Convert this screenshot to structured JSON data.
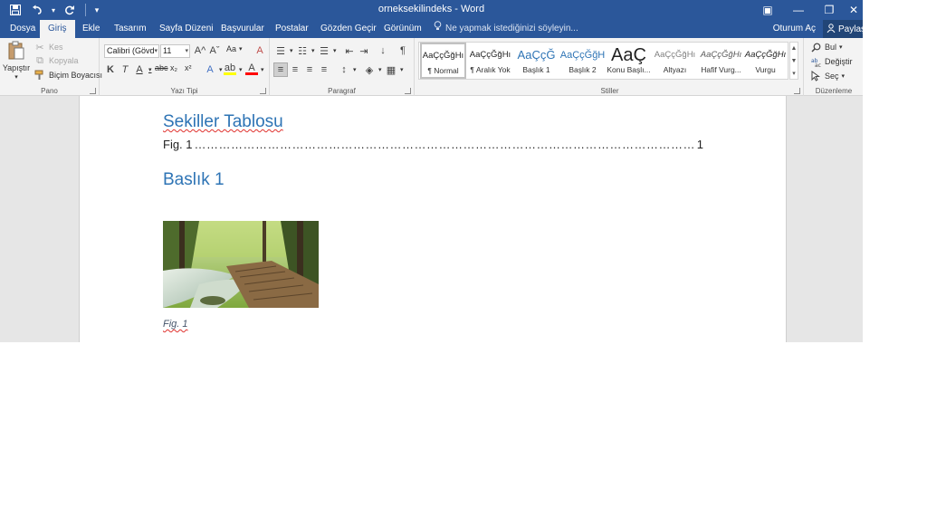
{
  "window": {
    "title": "orneksekilindeks - Word",
    "controls": {
      "ribbon_display": "▣",
      "minimize": "—",
      "restore": "❐",
      "close": "✕"
    }
  },
  "qat": {
    "save": "💾",
    "undo": "↶",
    "undo_dropdown": "▾",
    "redo": "↻",
    "customize": "▾"
  },
  "tabs": [
    {
      "label": "Dosya",
      "active": false
    },
    {
      "label": "Giriş",
      "active": true
    },
    {
      "label": "Ekle",
      "active": false
    },
    {
      "label": "Tasarım",
      "active": false
    },
    {
      "label": "Sayfa Düzeni",
      "active": false
    },
    {
      "label": "Başvurular",
      "active": false
    },
    {
      "label": "Postalar",
      "active": false
    },
    {
      "label": "Gözden Geçir",
      "active": false
    },
    {
      "label": "Görünüm",
      "active": false
    }
  ],
  "tell_me": {
    "placeholder": "Ne yapmak istediğinizi söyleyin..."
  },
  "account": {
    "signin": "Oturum Aç",
    "share": "Paylaş"
  },
  "clipboard": {
    "group_label": "Pano",
    "paste": "Yapıştır",
    "cut": "Kes",
    "copy": "Kopyala",
    "format_painter": "Biçim Boyacısı"
  },
  "font": {
    "group_label": "Yazı Tipi",
    "font_name": "Calibri (Gövd",
    "font_size": "11",
    "grow": "A^",
    "shrink": "Aˇ",
    "change_case": "Aa",
    "clear_formatting": "A",
    "bold": "K",
    "italic": "T",
    "underline": "A",
    "strikethrough": "abc",
    "subscript": "x₂",
    "superscript": "x²",
    "text_effects": "A",
    "highlight": "ab",
    "font_color": "A",
    "highlight_color": "#ffff00",
    "font_color_value": "#ff0000"
  },
  "paragraph": {
    "group_label": "Paragraf",
    "bullets": "☰",
    "numbering": "☷",
    "multilevel": "☰",
    "decrease_indent": "⇤",
    "increase_indent": "⇥",
    "sort": "↓",
    "show_marks": "¶",
    "align_left": "≡",
    "center": "≡",
    "align_right": "≡",
    "justify": "≡",
    "line_spacing": "↕",
    "shading": "◈",
    "borders": "▦"
  },
  "styles": {
    "group_label": "Stiller",
    "items": [
      {
        "sample": "AaÇçĞğHı",
        "name": "¶ Normal",
        "color": "#222222"
      },
      {
        "sample": "AaÇçĞğHı",
        "name": "¶ Aralık Yok",
        "color": "#222222"
      },
      {
        "sample": "AaÇçĞ",
        "name": "Başlık 1",
        "color": "#2e74b5"
      },
      {
        "sample": "AaÇçĞğH",
        "name": "Başlık 2",
        "color": "#2e74b5"
      },
      {
        "sample": "AaÇ",
        "name": "Konu Başlı...",
        "color": "#222222"
      },
      {
        "sample": "AaÇçĞğHı",
        "name": "Altyazı",
        "color": "#7f7f7f"
      },
      {
        "sample": "AaÇçĞğHı",
        "name": "Hafif Vurg...",
        "color": "#595959"
      },
      {
        "sample": "AaÇçĞğHı",
        "name": "Vurgu",
        "color": "#222222"
      }
    ]
  },
  "editing": {
    "group_label": "Düzenleme",
    "find": "Bul",
    "replace": "Değiştir",
    "select": "Seç"
  },
  "document": {
    "toc_heading": "Sekiller Tablosu",
    "toc_entry": {
      "label": "Fig. 1",
      "page": "1"
    },
    "heading1": "Baslık 1",
    "caption": "Fig. 1",
    "image_subject": "forest-stream-boardwalk"
  }
}
